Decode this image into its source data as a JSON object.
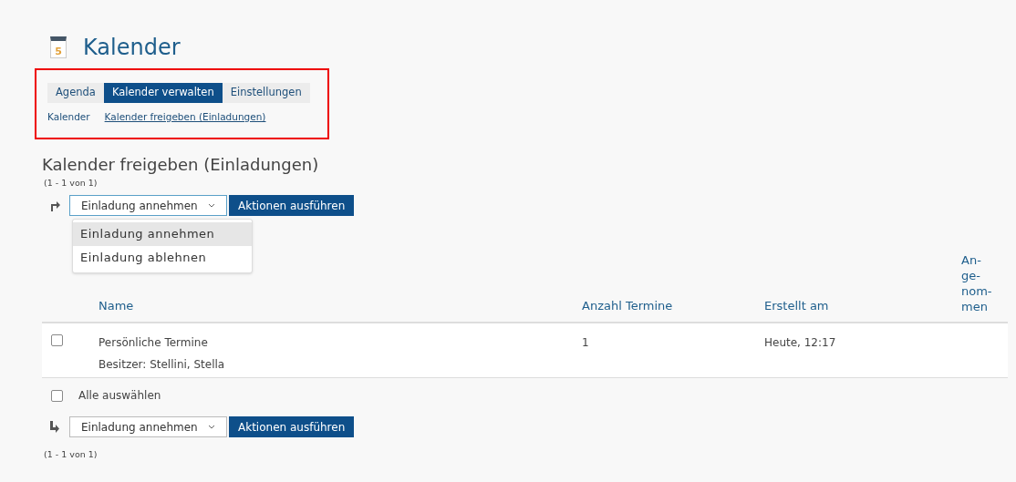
{
  "header": {
    "icon_digit": "5",
    "title": "Kalender"
  },
  "tabs": [
    {
      "label": "Agenda",
      "selected": false
    },
    {
      "label": "Kalender verwalten",
      "selected": true
    },
    {
      "label": "Einstellungen",
      "selected": false
    }
  ],
  "subnav": [
    {
      "label": "Kalender",
      "selected": false
    },
    {
      "label": "Kalender freigeben (Einladungen)",
      "selected": true
    }
  ],
  "section_title": "Kalender freigeben (Einladungen)",
  "count_top": "(1 - 1 von 1)",
  "top_actions": {
    "select_value": "Einladung annehmen",
    "button": "Aktionen ausführen",
    "expanded": true,
    "options": [
      {
        "label": "Einladung annehmen",
        "highlighted": true
      },
      {
        "label": "Einladung ablehnen",
        "highlighted": false
      }
    ]
  },
  "table": {
    "columns": [
      "Name",
      "Anzahl Termine",
      "Erstellt am",
      "An-ge-nom-men"
    ],
    "rows": [
      {
        "checked": false,
        "name": "Persönliche Termine",
        "owner": "Besitzer: Stellini, Stella",
        "count": "1",
        "created": "Heute, 12:17"
      }
    ]
  },
  "select_all": {
    "label": "Alle auswählen",
    "checked": false
  },
  "bottom_actions": {
    "select_value": "Einladung annehmen",
    "button": "Aktionen ausführen"
  },
  "count_bottom": "(1 - 1 von 1)"
}
